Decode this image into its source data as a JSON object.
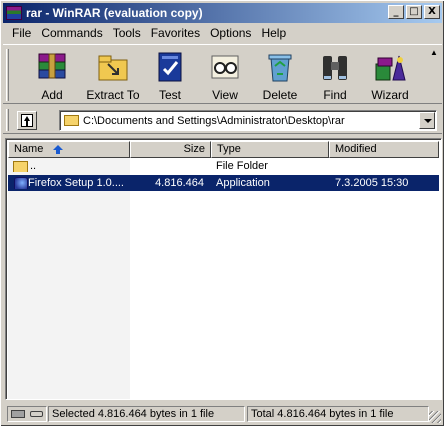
{
  "window": {
    "title": "rar - WinRAR (evaluation copy)",
    "controls": [
      "_",
      "□",
      "X"
    ]
  },
  "menu": [
    {
      "label": "File"
    },
    {
      "label": "Commands"
    },
    {
      "label": "Tools"
    },
    {
      "label": "Favorites"
    },
    {
      "label": "Options"
    },
    {
      "label": "Help"
    }
  ],
  "toolbar": {
    "buttons": [
      {
        "label": "Add",
        "icon": "books-icon"
      },
      {
        "label": "Extract To",
        "icon": "extract-folder-icon"
      },
      {
        "label": "Test",
        "icon": "test-book-icon"
      },
      {
        "label": "View",
        "icon": "glasses-icon"
      },
      {
        "label": "Delete",
        "icon": "recycle-bin-icon"
      },
      {
        "label": "Find",
        "icon": "binoculars-icon"
      },
      {
        "label": "Wizard",
        "icon": "wizard-icon"
      }
    ]
  },
  "address": {
    "path": "C:\\Documents and Settings\\Administrator\\Desktop\\rar"
  },
  "filelist": {
    "columns": {
      "name": "Name",
      "size": "Size",
      "type": "Type",
      "modified": "Modified"
    },
    "rows": [
      {
        "name": "..",
        "size": "",
        "type": "File Folder",
        "modified": "",
        "icon": "folder-icon",
        "selected": false
      },
      {
        "name": "Firefox Setup 1.0....",
        "size": "4.816.464",
        "type": "Application",
        "modified": "7.3.2005 15:30",
        "icon": "application-icon",
        "selected": true
      }
    ]
  },
  "status": {
    "selected": "Selected 4.816.464 bytes in 1 file",
    "total": "Total 4.816.464 bytes in 1 file"
  },
  "colors": {
    "title_gradient_start": "#0a246a",
    "title_gradient_end": "#a6caf0",
    "selection": "#0a246a",
    "chrome": "#d4d0c8"
  }
}
